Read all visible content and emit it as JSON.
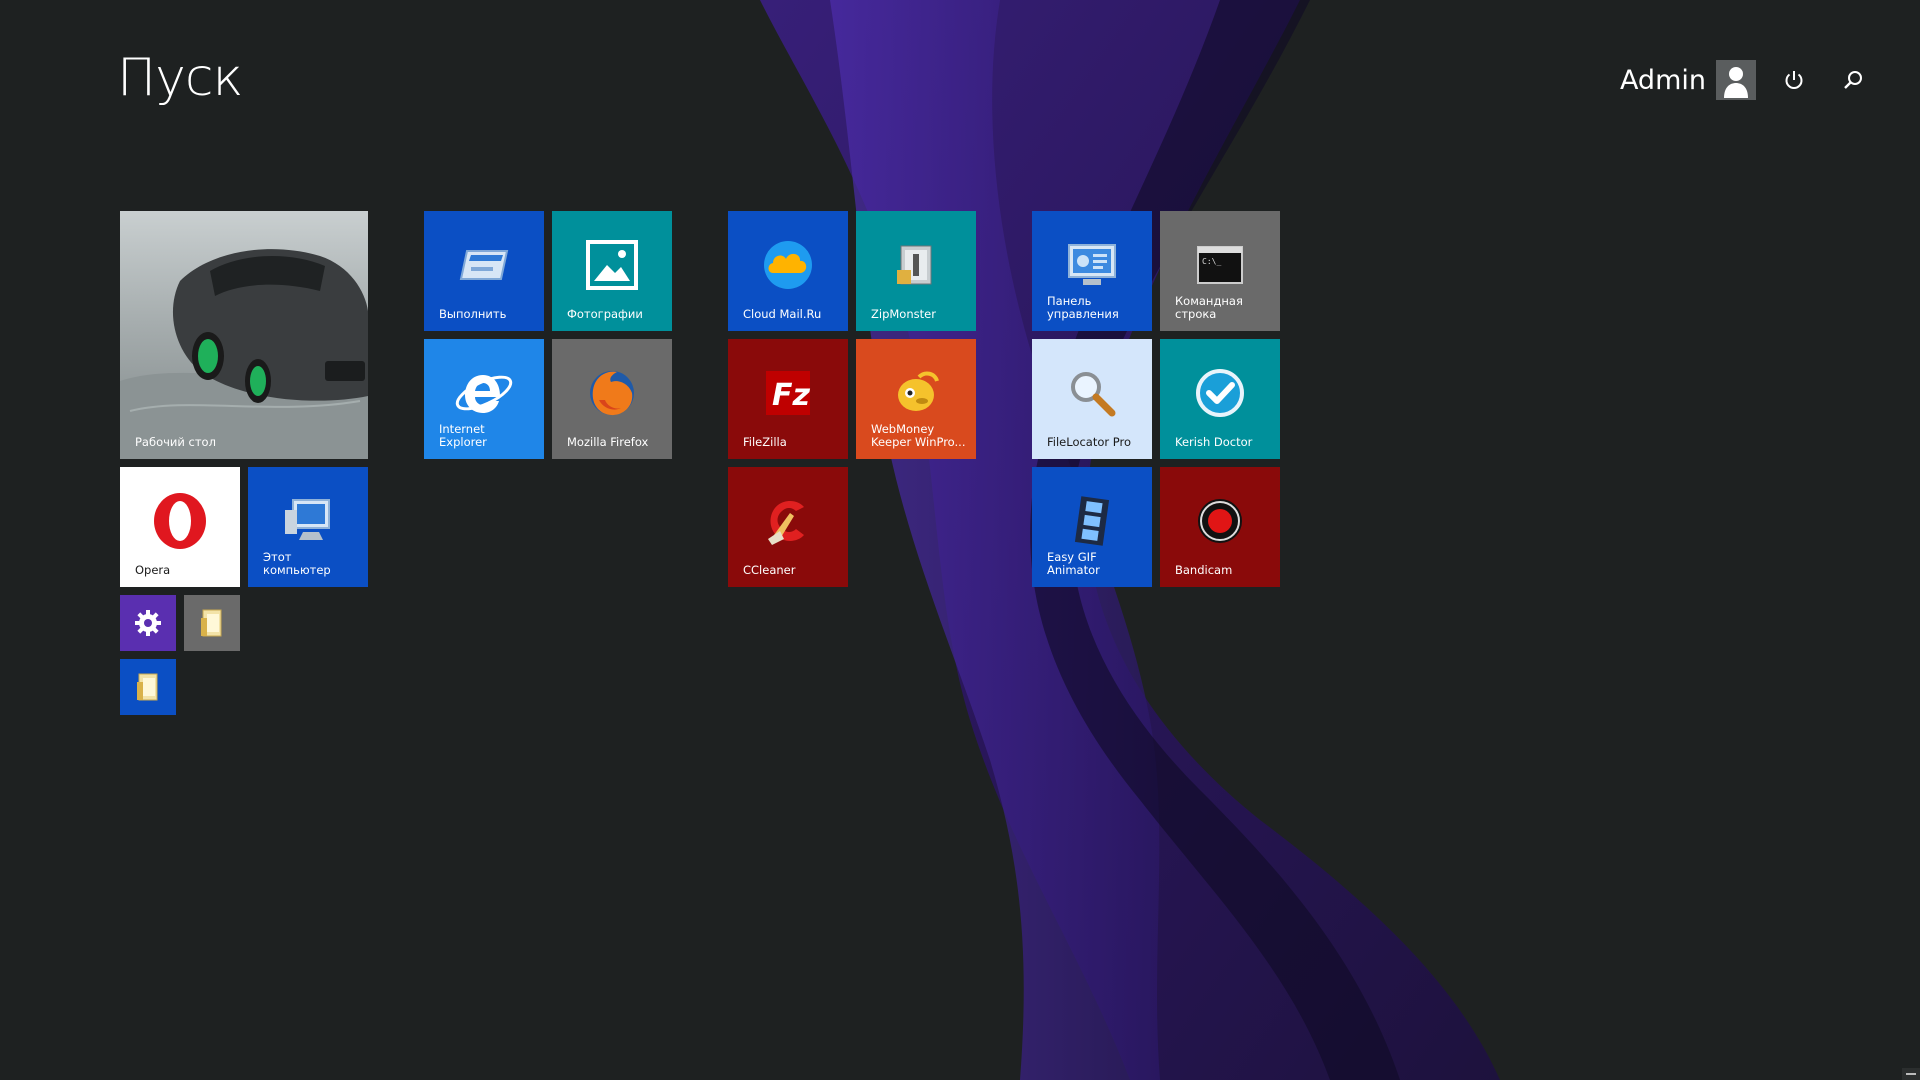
{
  "start": {
    "title": "Пуск"
  },
  "user": {
    "name": "Admin"
  },
  "tiles": {
    "desktop": {
      "label": "Рабочий стол"
    },
    "opera": {
      "label": "Opera"
    },
    "this_pc": {
      "label": "Этот компьютер"
    },
    "run": {
      "label": "Выполнить"
    },
    "photos": {
      "label": "Фотографии"
    },
    "ie": {
      "label": "Internet Explorer"
    },
    "firefox": {
      "label": "Mozilla Firefox"
    },
    "cloud_mail": {
      "label": "Cloud Mail.Ru"
    },
    "zipmonster": {
      "label": "ZipMonster"
    },
    "filezilla": {
      "label": "FileZilla"
    },
    "webmoney": {
      "label": "WebMoney\nKeeper WinPro..."
    },
    "ccleaner": {
      "label": "CCleaner"
    },
    "control_panel": {
      "label": "Панель\nуправления"
    },
    "cmd": {
      "label": "Командная\nстрока"
    },
    "filelocator": {
      "label": "FileLocator Pro"
    },
    "kerish": {
      "label": "Kerish Doctor"
    },
    "easygif": {
      "label": "Easy GIF\nAnimator"
    },
    "bandicam": {
      "label": "Bandicam"
    }
  },
  "colors": {
    "background": "#1e2121",
    "tile_blue": "#0b4fc4",
    "tile_teal": "#00909b",
    "tile_gray": "#6a6a6a",
    "tile_red": "#8a0a0a",
    "tile_orange": "#d94a1e",
    "tile_purple": "#5a2fb0",
    "tile_ie_blue": "#1f86e8",
    "tile_light": "#d4e6fb"
  },
  "icons": {
    "power": "power-icon",
    "search": "search-icon",
    "settings": "gear-icon",
    "folder": "folder-icon"
  }
}
